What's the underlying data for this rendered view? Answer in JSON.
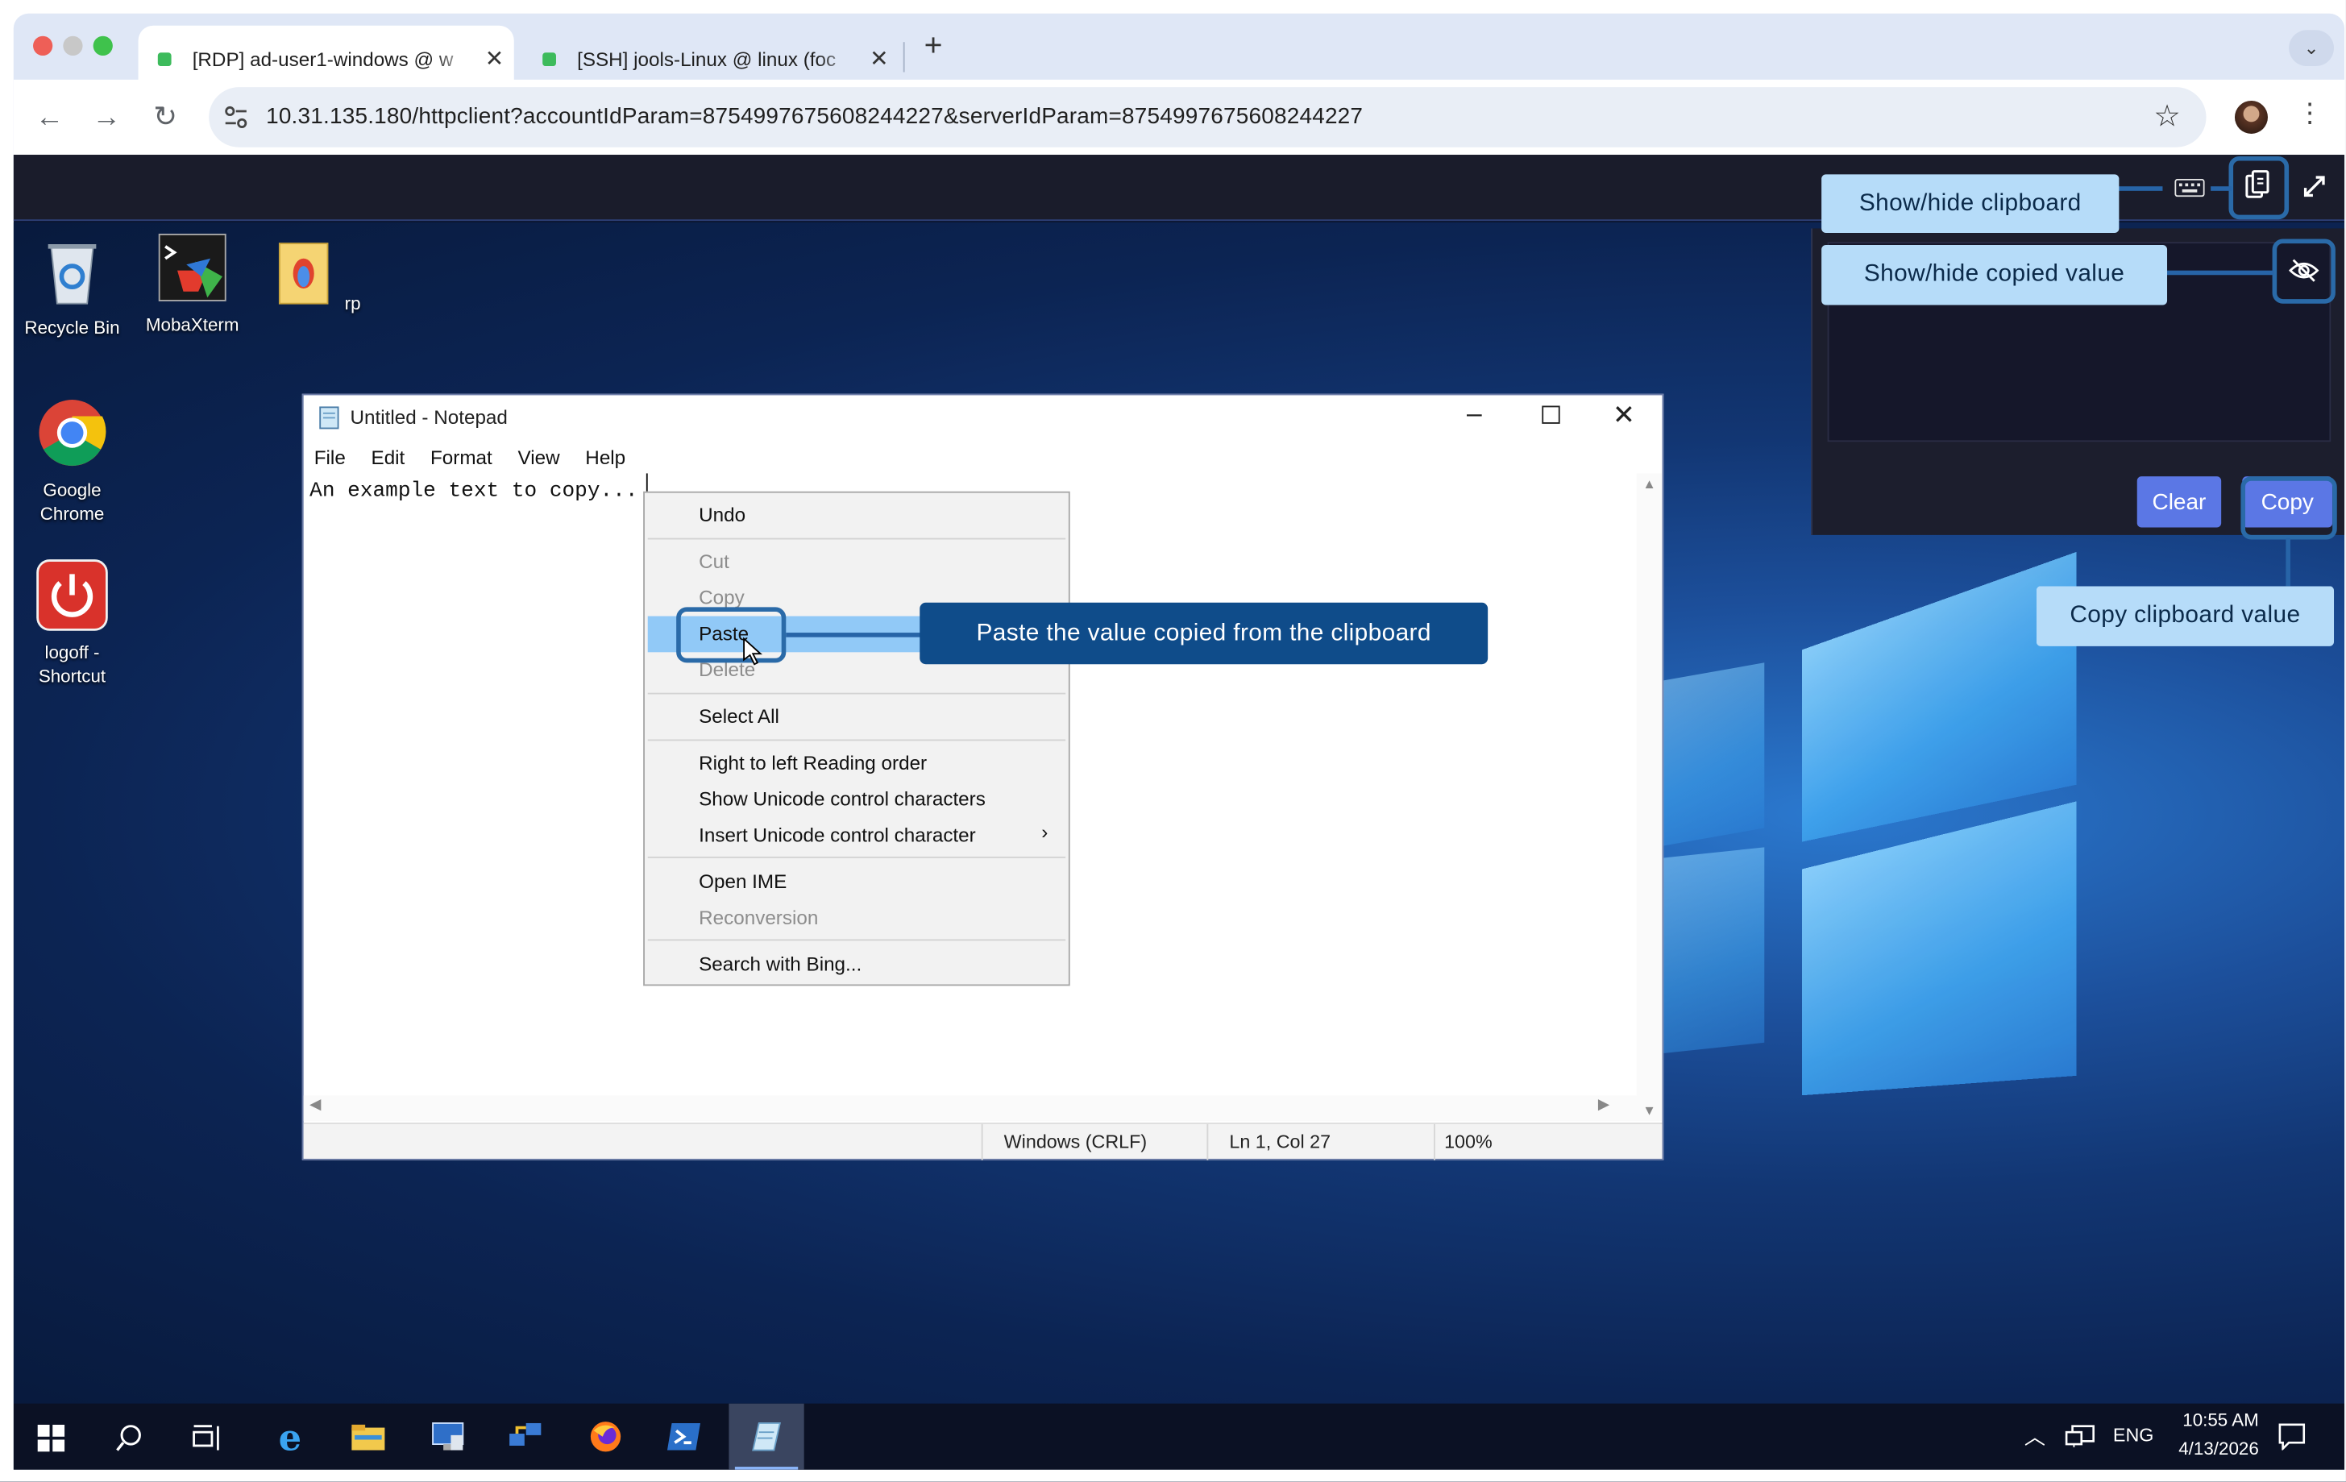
{
  "browser": {
    "tabs": [
      {
        "label": "[RDP] ad-user1-windows @ w",
        "active": true
      },
      {
        "label": "[SSH] jools-Linux @ linux (foc",
        "active": false
      }
    ],
    "new_tab": "+",
    "url": "10.31.135.180/httpclient?accountIdParam=8754997675608244227&serverIdParam=8754997675608244227"
  },
  "desktop_icons": [
    {
      "label": "Recycle Bin"
    },
    {
      "label": "MobaXterm"
    },
    {
      "label": "rp"
    },
    {
      "label": "Google Chrome"
    },
    {
      "label": "logoff - Shortcut"
    }
  ],
  "notepad": {
    "title": "Untitled - Notepad",
    "menu": [
      "File",
      "Edit",
      "Format",
      "View",
      "Help"
    ],
    "text": "An example text to copy...",
    "status": {
      "encoding": "Windows (CRLF)",
      "position": "Ln 1, Col 27",
      "zoom": "100%"
    }
  },
  "context_menu": {
    "items": [
      {
        "label": "Undo",
        "enabled": true
      },
      {
        "label": "Cut",
        "enabled": false
      },
      {
        "label": "Copy",
        "enabled": false
      },
      {
        "label": "Paste",
        "enabled": true,
        "highlighted": true
      },
      {
        "label": "Delete",
        "enabled": false
      },
      {
        "label": "Select All",
        "enabled": true
      },
      {
        "label": "Right to left Reading order",
        "enabled": true
      },
      {
        "label": "Show Unicode control characters",
        "enabled": true
      },
      {
        "label": "Insert Unicode control character",
        "enabled": true,
        "submenu": true
      },
      {
        "label": "Open IME",
        "enabled": true
      },
      {
        "label": "Reconversion",
        "enabled": false
      },
      {
        "label": "Search with Bing...",
        "enabled": true
      }
    ]
  },
  "callouts": {
    "show_hide_clipboard": "Show/hide clipboard",
    "show_hide_copied": "Show/hide copied value",
    "paste": "Paste the value copied from the clipboard",
    "copy_value": "Copy clipboard value"
  },
  "clipboard_panel": {
    "clear_label": "Clear",
    "copy_label": "Copy"
  },
  "tray": {
    "language": "ENG",
    "time": "10:55 AM",
    "date": "4/13/2026"
  },
  "colors": {
    "accent_button": "#5b77e5",
    "callout_bg": "#b6dcf9",
    "callout_dark": "#0f4c8a"
  }
}
